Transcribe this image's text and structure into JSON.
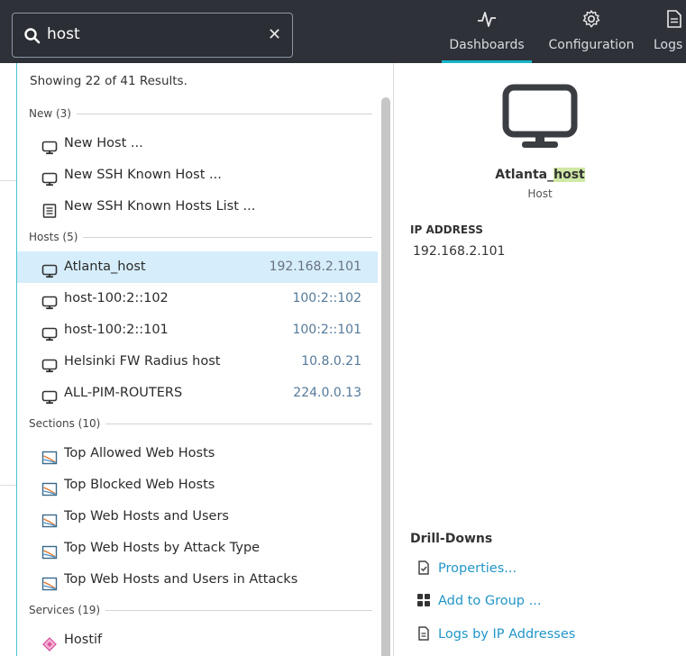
{
  "search": {
    "value": "host"
  },
  "nav": {
    "dashboards": {
      "label": "Dashboards",
      "icon": "pulse-icon"
    },
    "configuration": {
      "label": "Configuration",
      "icon": "gear-icon"
    },
    "logs": {
      "label": "Logs",
      "icon": "document-icon"
    }
  },
  "results": {
    "summary": "Showing 22 of 41 Results."
  },
  "groups": [
    {
      "header": "New (3)",
      "items": [
        {
          "label": "New Host ...",
          "icon": "monitor-icon",
          "value": ""
        },
        {
          "label": "New SSH Known Host ...",
          "icon": "monitor-icon",
          "value": ""
        },
        {
          "label": "New SSH Known Hosts List ...",
          "icon": "list-icon",
          "value": ""
        }
      ]
    },
    {
      "header": "Hosts (5)",
      "items": [
        {
          "label": "Atlanta_host",
          "icon": "monitor-icon",
          "value": "192.168.2.101"
        },
        {
          "label": "host-100:2::102",
          "icon": "monitor-icon",
          "value": "100:2::102"
        },
        {
          "label": "host-100:2::101",
          "icon": "monitor-icon",
          "value": "100:2::101"
        },
        {
          "label": "Helsinki FW Radius host",
          "icon": "monitor-icon",
          "value": "10.8.0.21"
        },
        {
          "label": "ALL-PIM-ROUTERS",
          "icon": "monitor-icon",
          "value": "224.0.0.13"
        }
      ]
    },
    {
      "header": "Sections (10)",
      "items": [
        {
          "label": "Top Allowed Web Hosts",
          "icon": "chart-icon",
          "value": ""
        },
        {
          "label": "Top Blocked Web Hosts",
          "icon": "chart-icon",
          "value": ""
        },
        {
          "label": "Top Web Hosts and Users",
          "icon": "chart-icon",
          "value": ""
        },
        {
          "label": "Top Web Hosts by Attack Type",
          "icon": "chart-icon",
          "value": ""
        },
        {
          "label": "Top Web Hosts and Users in Attacks",
          "icon": "chart-icon",
          "value": ""
        }
      ]
    },
    {
      "header": "Services (19)",
      "items": [
        {
          "label": "Hostif",
          "icon": "diamond-icon",
          "value": ""
        }
      ]
    }
  ],
  "detail": {
    "name_prefix": "Atlanta_",
    "name_highlight": "host",
    "type": "Host",
    "ip_title": "IP ADDRESS",
    "ip_value": "192.168.2.101",
    "drill_title": "Drill-Downs",
    "links": [
      {
        "label": "Properties...",
        "icon": "properties-icon"
      },
      {
        "label": "Add to Group ...",
        "icon": "grid-icon"
      },
      {
        "label": "Logs by IP Addresses",
        "icon": "document-icon"
      }
    ]
  },
  "colors": {
    "topbar": "#2e3138",
    "accent": "#17b7c9",
    "selected": "#d6eefb",
    "link": "#2196c9",
    "highlight": "#cfe8a6"
  }
}
